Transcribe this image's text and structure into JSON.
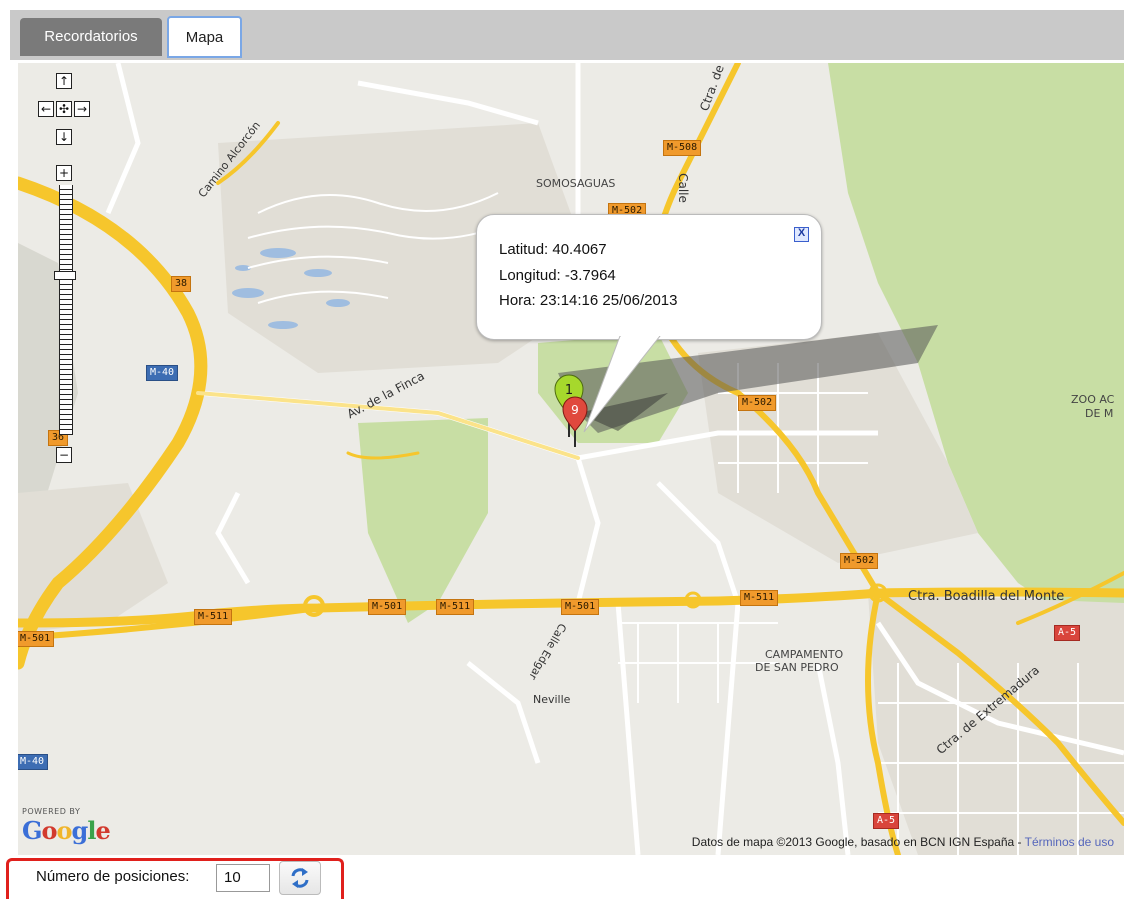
{
  "tabs": [
    {
      "label": "Recordatorios",
      "active": false
    },
    {
      "label": "Mapa",
      "active": true
    }
  ],
  "map": {
    "place_labels": {
      "somosaguas": "SOMOSAGUAS",
      "campamento_1": "CAMPAMENTO",
      "campamento_2": "DE SAN PEDRO",
      "zoo_1": "ZOO AC",
      "zoo_2": "DE M"
    },
    "street_labels": {
      "camino_alcorcon": "Camino Alcorcón",
      "av_finca": "Av. de la Finca",
      "ctra_boadilla": "Ctra. Boadilla del Monte",
      "ctra_extremadura": "Ctra. de Extremadura",
      "calle": "Calle",
      "ctra_de": "Ctra. de",
      "calle_edgar": "Calle Edgar",
      "neville": "Neville"
    },
    "road_shields": {
      "m508": "M-508",
      "m502a": "M-502",
      "m502b": "M-502",
      "m502c": "M-502",
      "m40a": "M-40",
      "m40b": "M-40",
      "m511a": "M-511",
      "m511b": "M-511",
      "m511c": "M-511",
      "m501a": "M-501",
      "m501b": "M-501",
      "m501c": "M-501",
      "n38": "38",
      "n36": "36",
      "a5a": "A-5",
      "a5b": "A-5"
    },
    "markers": [
      {
        "label": "1",
        "color": "#a6d82c"
      },
      {
        "label": "9",
        "color": "#e0493d"
      }
    ],
    "popup": {
      "latitude": "Latitud: 40.4067",
      "longitude": "Longitud: -3.7964",
      "time": "Hora: 23:14:16 25/06/2013",
      "close": "X"
    },
    "attribution": {
      "text": "Datos de mapa ©2013 Google, basado en BCN IGN España - ",
      "terms": "Términos de uso"
    },
    "powered_by": "POWERED BY",
    "google_logo": "Google",
    "nav": {
      "up": "↑",
      "down": "↓",
      "left": "←",
      "right": "→",
      "center": "✣",
      "zoom_in": "+",
      "zoom_out": "−"
    },
    "colors": {
      "background": "#ecebe6",
      "park": "#c8dea4",
      "highway": "#f6c62c",
      "road": "#ffffff"
    }
  },
  "positions": {
    "label": "Número de posiciones:",
    "value": "10",
    "refresh_icon": "refresh-icon"
  }
}
